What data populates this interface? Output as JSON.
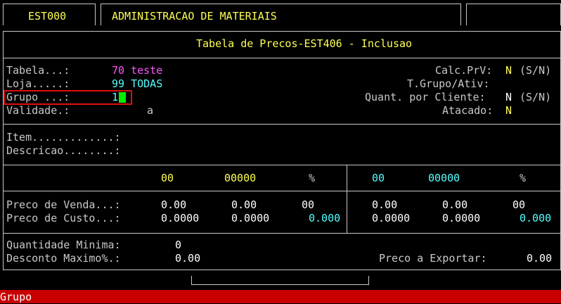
{
  "header": {
    "code": "EST000",
    "system": "ADMINISTRACAO DE MATERIAIS"
  },
  "screen_title": "Tabela de Precos-EST406 - Inclusao",
  "form": {
    "tabela_label": "Tabela...:",
    "tabela_value": "70 teste",
    "loja_label": "Loja.....:",
    "loja_value": "99 TODAS",
    "grupo_label": "Grupo ...:",
    "grupo_value": "1",
    "validade_label": "Validade.:",
    "validade_sep": "a",
    "calcprv_label": "Calc.PrV:",
    "calcprv_value": "N",
    "calcprv_hint": "(S/N)",
    "tgrupo_label": "T.Grupo/Ativ:",
    "quant_label": "Quant. por Cliente:",
    "quant_value": "N",
    "quant_hint": "(S/N)",
    "atacado_label": "Atacado:",
    "atacado_value": "N"
  },
  "item": {
    "item_label": "Item.............:",
    "desc_label": "Descricao........:"
  },
  "price_headers": {
    "left": {
      "a": "00",
      "b": "00000",
      "pct": "%"
    },
    "right": {
      "a": "00",
      "b": "00000",
      "pct": "%"
    }
  },
  "prices": {
    "venda_label": "Preco de Venda...:",
    "custo_label": "Preco de Custo...:",
    "venda_left": [
      "0.00",
      "0.00",
      "00"
    ],
    "venda_right": [
      "0.00",
      "0.00",
      "00"
    ],
    "custo_left": [
      "0.0000",
      "0.0000",
      "0.000"
    ],
    "custo_right": [
      "0.0000",
      "0.0000",
      "0.000"
    ]
  },
  "bottom": {
    "qtd_label": "Quantidade Minima:",
    "qtd_value": "0",
    "desc_label": "Desconto Maximo%.:",
    "desc_value": "0.00",
    "export_label": "Preco a Exportar:",
    "export_value": "0.00"
  },
  "status_bar": "Grupo"
}
